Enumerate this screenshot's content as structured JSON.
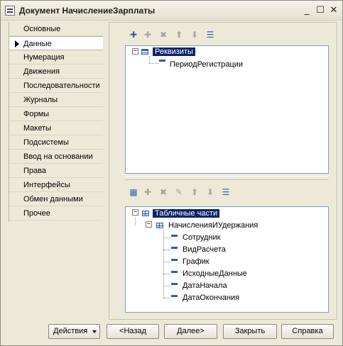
{
  "window": {
    "title": "Документ НачислениеЗарплаты",
    "controls": {
      "minimize": "_",
      "maximize": "☐",
      "close": "✕"
    }
  },
  "nav": {
    "items": [
      {
        "label": "Основные"
      },
      {
        "label": "Данные",
        "active": true
      },
      {
        "label": "Нумерация"
      },
      {
        "label": "Движения"
      },
      {
        "label": "Последовательности"
      },
      {
        "label": "Журналы"
      },
      {
        "label": "Формы"
      },
      {
        "label": "Макеты"
      },
      {
        "label": "Подсистемы"
      },
      {
        "label": "Ввод на основании"
      },
      {
        "label": "Права"
      },
      {
        "label": "Интерфейсы"
      },
      {
        "label": "Обмен данными"
      },
      {
        "label": "Прочее"
      }
    ]
  },
  "upper_tree": {
    "root": {
      "label": "Реквизиты",
      "expander": "−",
      "icon": "folder-icon"
    },
    "children": [
      {
        "label": "ПериодРегистрации",
        "icon": "attribute-icon"
      }
    ]
  },
  "lower_tree": {
    "root": {
      "label": "Табличные части",
      "expander": "−",
      "icon": "table-icon"
    },
    "table": {
      "label": "НачисленияИУдержания",
      "expander": "−",
      "icon": "table-icon"
    },
    "columns": [
      {
        "label": "Сотрудник"
      },
      {
        "label": "ВидРасчета"
      },
      {
        "label": "График"
      },
      {
        "label": "ИсходныеДанные"
      },
      {
        "label": "ДатаНачала"
      },
      {
        "label": "ДатаОкончания"
      }
    ]
  },
  "toolbar_icons": {
    "upper": [
      "add-icon",
      "add-child-icon",
      "delete-icon",
      "move-up-icon",
      "move-down-icon",
      "sort-icon"
    ],
    "lower": [
      "add-icon",
      "add-child-icon",
      "delete-icon",
      "edit-icon",
      "move-up-icon",
      "move-down-icon",
      "sort-icon"
    ]
  },
  "buttons": {
    "actions": "Действия",
    "back": "<Назад",
    "next": "Далее>",
    "close": "Закрыть",
    "help": "Справка"
  },
  "colors": {
    "window_bg": "#ece9d8",
    "selection": "#0a246a",
    "icon_blue": "#2f5ea8",
    "tree_border": "#7f9db9"
  }
}
